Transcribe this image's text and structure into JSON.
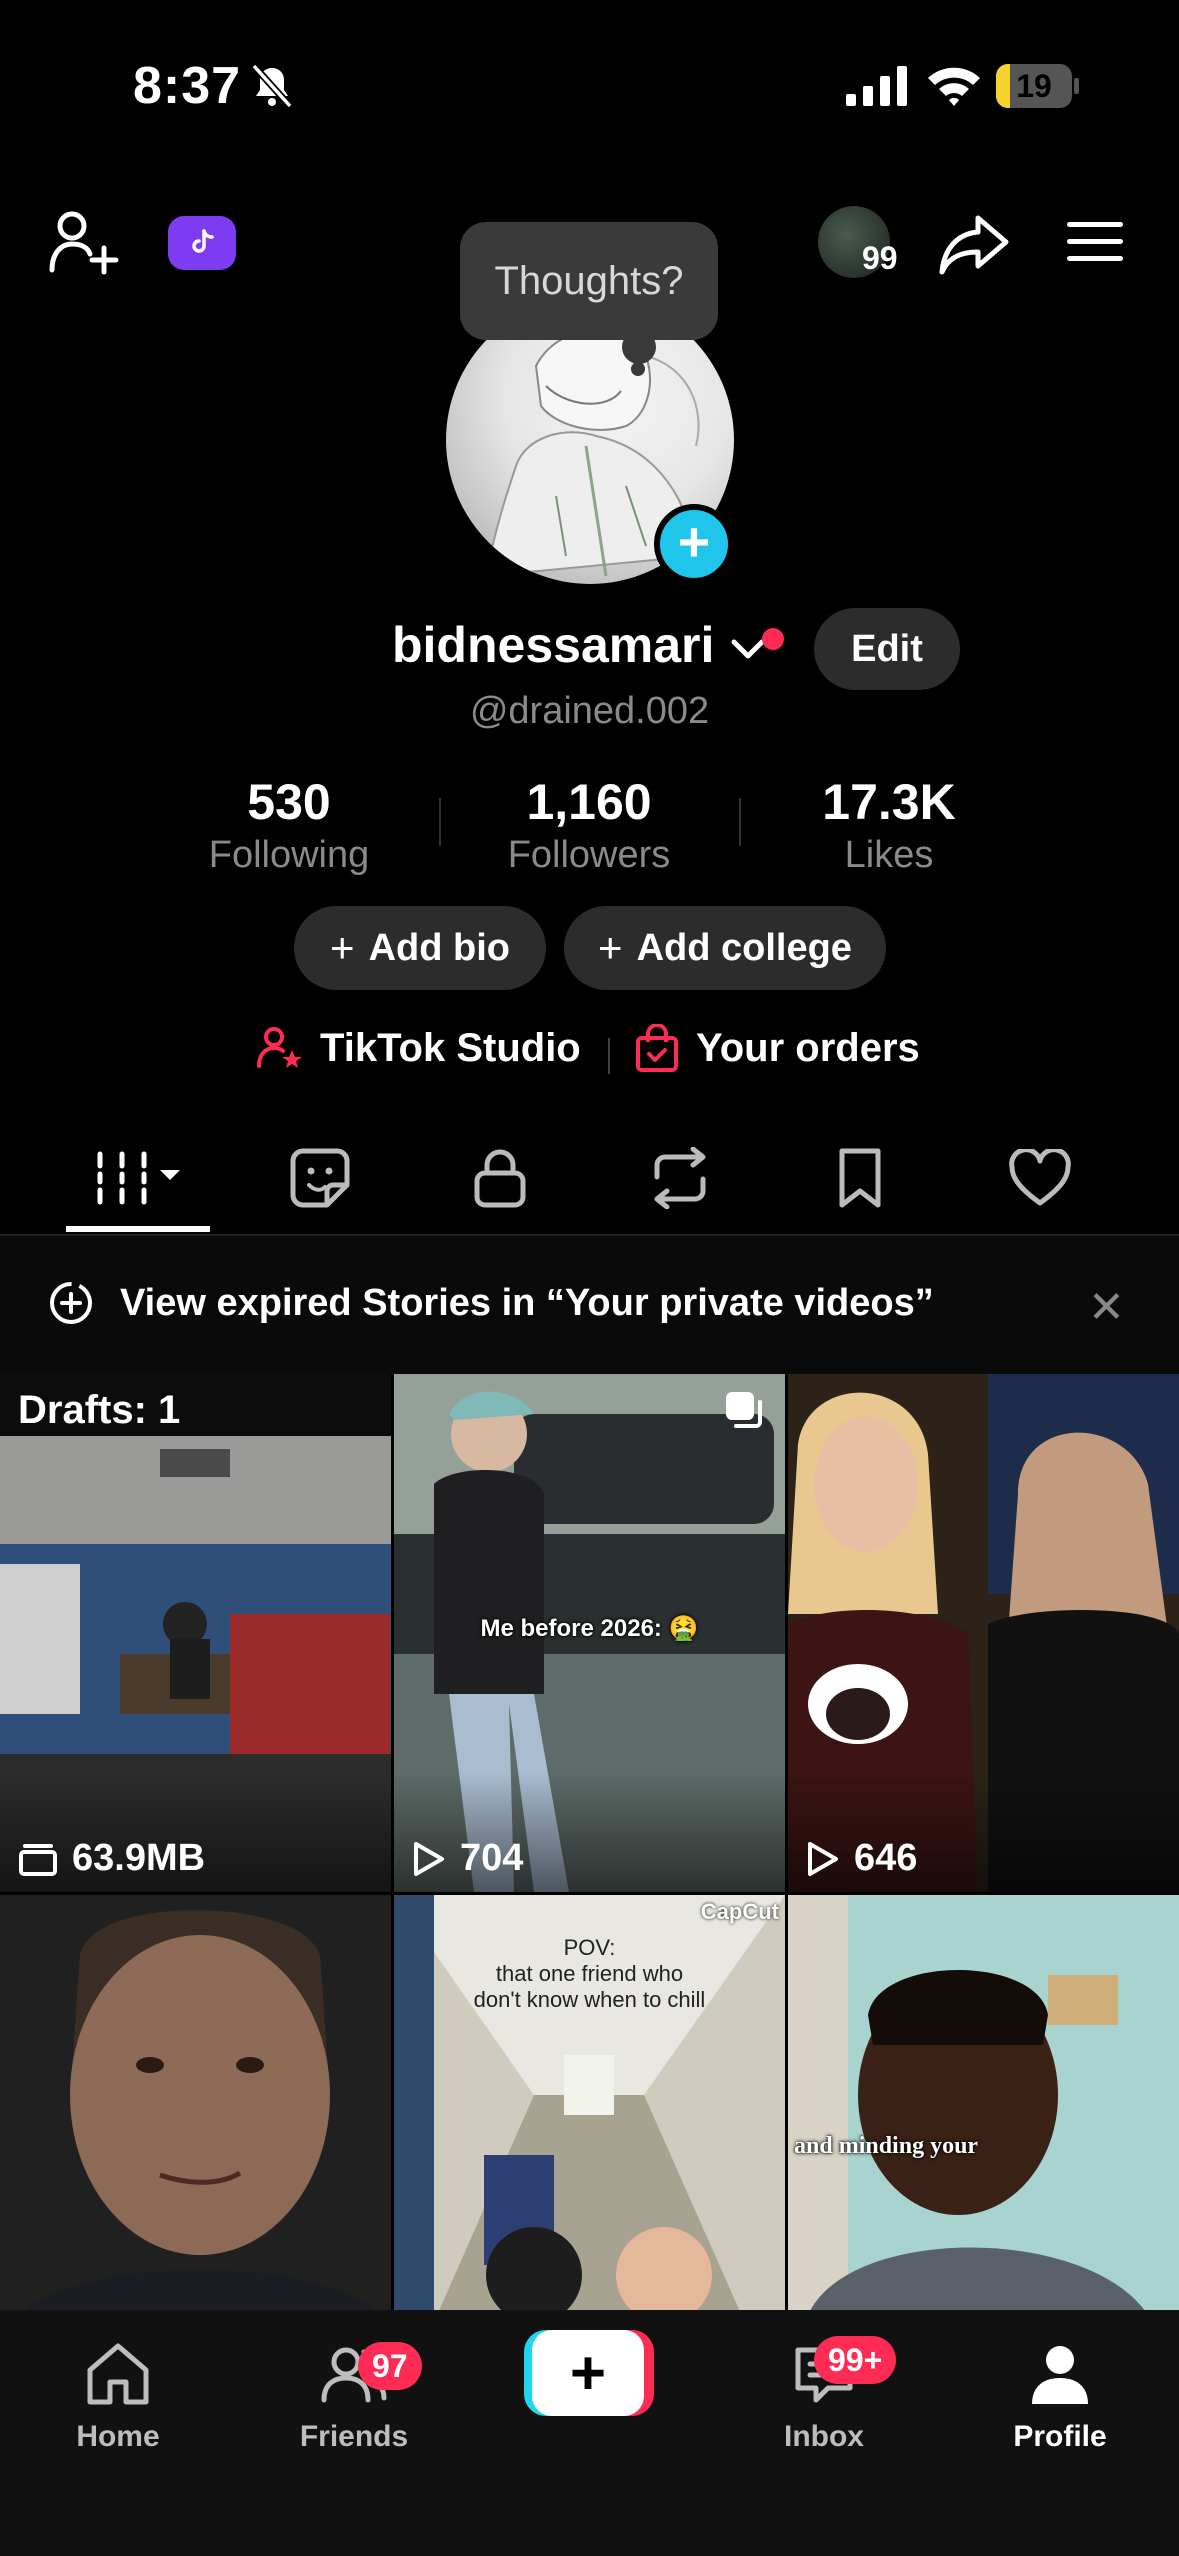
{
  "status_bar": {
    "time": "8:37",
    "battery": "19",
    "battery_level": 0.19
  },
  "top_bar": {
    "notification_count": "99"
  },
  "tooltip": {
    "text": "Thoughts?"
  },
  "profile": {
    "display_name": "bidnessamari",
    "handle": "@drained.002",
    "edit_label": "Edit",
    "stats": [
      {
        "value": "530",
        "label": "Following"
      },
      {
        "value": "1,160",
        "label": "Followers"
      },
      {
        "value": "17.3K",
        "label": "Likes"
      }
    ],
    "add_bio": "Add bio",
    "add_college": "Add college",
    "studio": "TikTok Studio",
    "orders": "Your orders"
  },
  "banner": {
    "text": "View expired Stories in “Your private videos”"
  },
  "grid": {
    "drafts": "Drafts: 1",
    "items": [
      {
        "type": "draft",
        "count": "63.9MB"
      },
      {
        "type": "video",
        "count": "704",
        "caption": "Me before 2026: 🤮"
      },
      {
        "type": "video",
        "count": "646"
      },
      {
        "type": "video"
      },
      {
        "type": "video",
        "caption": "POV:\nthat one friend who\ndon't know when to chill",
        "watermark": "CapCut"
      },
      {
        "type": "video",
        "caption": "and minding your"
      }
    ]
  },
  "bottom_nav": {
    "home": "Home",
    "friends": "Friends",
    "friends_badge": "97",
    "inbox": "Inbox",
    "inbox_badge": "99+",
    "profile": "Profile"
  },
  "colors": {
    "accent_red": "#fe2c55",
    "accent_cyan": "#20c5eb",
    "promo_purple": "#7d3cf2"
  }
}
